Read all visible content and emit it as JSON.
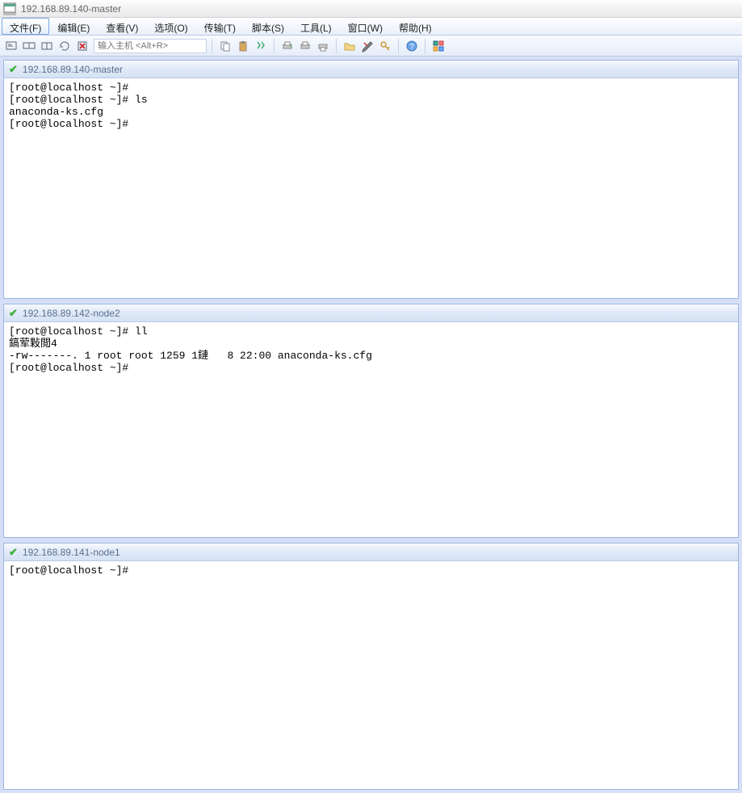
{
  "window": {
    "title": "192.168.89.140-master"
  },
  "menu": {
    "items": [
      {
        "label": "文件(F)",
        "active": true
      },
      {
        "label": "编辑(E)",
        "active": false
      },
      {
        "label": "查看(V)",
        "active": false
      },
      {
        "label": "选项(O)",
        "active": false
      },
      {
        "label": "传输(T)",
        "active": false
      },
      {
        "label": "脚本(S)",
        "active": false
      },
      {
        "label": "工具(L)",
        "active": false
      },
      {
        "label": "窗口(W)",
        "active": false
      },
      {
        "label": "帮助(H)",
        "active": false
      }
    ]
  },
  "toolbar": {
    "host_placeholder": "输入主机 <Alt+R>",
    "buttons_left": [
      {
        "name": "step-in-icon",
        "glyph": "↳"
      },
      {
        "name": "step-over-icon",
        "glyph": "↱"
      },
      {
        "name": "copy-icon",
        "glyph": "❐"
      },
      {
        "name": "refresh-icon",
        "glyph": "↻"
      },
      {
        "name": "close-red-icon",
        "glyph": "✖"
      }
    ],
    "buttons_group2": [
      {
        "name": "copy-icon",
        "glyph": "📄"
      },
      {
        "name": "paste-icon",
        "glyph": "📋"
      },
      {
        "name": "find-icon",
        "glyph": "🔍"
      }
    ],
    "buttons_group3": [
      {
        "name": "print-icon",
        "glyph": "🖶"
      },
      {
        "name": "print-preview-icon",
        "glyph": "🖶"
      },
      {
        "name": "printer-icon",
        "glyph": "🖶"
      }
    ],
    "buttons_group4": [
      {
        "name": "folder-icon",
        "glyph": "📁"
      },
      {
        "name": "tools-icon",
        "glyph": "✖"
      },
      {
        "name": "key-icon",
        "glyph": "🔑"
      }
    ],
    "buttons_group5": [
      {
        "name": "help-icon",
        "glyph": "?"
      }
    ],
    "buttons_group6": [
      {
        "name": "window-icon",
        "glyph": "▣"
      }
    ]
  },
  "panes": [
    {
      "title": "192.168.89.140-master",
      "connected": true,
      "content": "[root@localhost ~]#\n[root@localhost ~]# ls\nanaconda-ks.cfg\n[root@localhost ~]#"
    },
    {
      "title": "192.168.89.142-node2",
      "connected": true,
      "content": "[root@localhost ~]# ll\n鎬荤敤閲4\n-rw-------. 1 root root 1259 1鏈   8 22:00 anaconda-ks.cfg\n[root@localhost ~]#"
    },
    {
      "title": "192.168.89.141-node1",
      "connected": true,
      "content": "[root@localhost ~]#"
    }
  ]
}
